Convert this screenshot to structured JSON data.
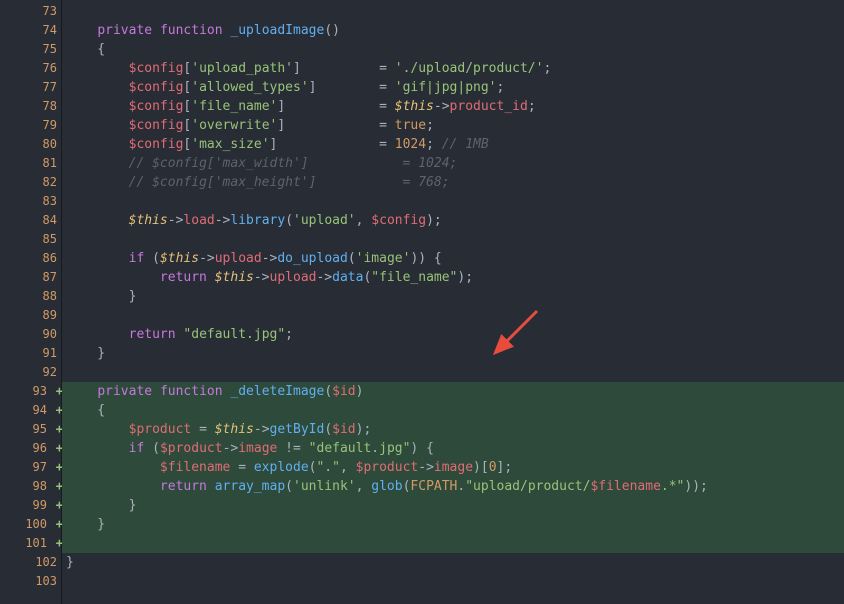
{
  "lines": [
    {
      "n": 73,
      "added": false,
      "tokens": [
        [
          "",
          ""
        ]
      ]
    },
    {
      "n": 74,
      "added": false,
      "tokens": [
        [
          "punct",
          "    "
        ],
        [
          "kw",
          "private"
        ],
        [
          "punct",
          " "
        ],
        [
          "kw",
          "function"
        ],
        [
          "punct",
          " "
        ],
        [
          "fn",
          "_uploadImage"
        ],
        [
          "punct",
          "()"
        ]
      ]
    },
    {
      "n": 75,
      "added": false,
      "tokens": [
        [
          "punct",
          "    {"
        ]
      ]
    },
    {
      "n": 76,
      "added": false,
      "tokens": [
        [
          "punct",
          "        "
        ],
        [
          "var",
          "$config"
        ],
        [
          "punct",
          "["
        ],
        [
          "str",
          "'upload_path'"
        ],
        [
          "punct",
          "]          = "
        ],
        [
          "str",
          "'./upload/product/'"
        ],
        [
          "punct",
          ";"
        ]
      ]
    },
    {
      "n": 77,
      "added": false,
      "tokens": [
        [
          "punct",
          "        "
        ],
        [
          "var",
          "$config"
        ],
        [
          "punct",
          "["
        ],
        [
          "str",
          "'allowed_types'"
        ],
        [
          "punct",
          "]        = "
        ],
        [
          "str",
          "'gif|jpg|png'"
        ],
        [
          "punct",
          ";"
        ]
      ]
    },
    {
      "n": 78,
      "added": false,
      "tokens": [
        [
          "punct",
          "        "
        ],
        [
          "var",
          "$config"
        ],
        [
          "punct",
          "["
        ],
        [
          "str",
          "'file_name'"
        ],
        [
          "punct",
          "]            = "
        ],
        [
          "this",
          "$this"
        ],
        [
          "punct",
          "->"
        ],
        [
          "prop",
          "product_id"
        ],
        [
          "punct",
          ";"
        ]
      ]
    },
    {
      "n": 79,
      "added": false,
      "tokens": [
        [
          "punct",
          "        "
        ],
        [
          "var",
          "$config"
        ],
        [
          "punct",
          "["
        ],
        [
          "str",
          "'overwrite'"
        ],
        [
          "punct",
          "]            = "
        ],
        [
          "bool",
          "true"
        ],
        [
          "punct",
          ";"
        ]
      ]
    },
    {
      "n": 80,
      "added": false,
      "tokens": [
        [
          "punct",
          "        "
        ],
        [
          "var",
          "$config"
        ],
        [
          "punct",
          "["
        ],
        [
          "str",
          "'max_size'"
        ],
        [
          "punct",
          "]             = "
        ],
        [
          "num",
          "1024"
        ],
        [
          "punct",
          "; "
        ],
        [
          "cmt",
          "// 1MB"
        ]
      ]
    },
    {
      "n": 81,
      "added": false,
      "tokens": [
        [
          "punct",
          "        "
        ],
        [
          "cmt",
          "// $config['max_width']            = 1024;"
        ]
      ]
    },
    {
      "n": 82,
      "added": false,
      "tokens": [
        [
          "punct",
          "        "
        ],
        [
          "cmt",
          "// $config['max_height']           = 768;"
        ]
      ]
    },
    {
      "n": 83,
      "added": false,
      "tokens": [
        [
          "",
          ""
        ]
      ]
    },
    {
      "n": 84,
      "added": false,
      "tokens": [
        [
          "punct",
          "        "
        ],
        [
          "this",
          "$this"
        ],
        [
          "punct",
          "->"
        ],
        [
          "prop",
          "load"
        ],
        [
          "punct",
          "->"
        ],
        [
          "call",
          "library"
        ],
        [
          "punct",
          "("
        ],
        [
          "str",
          "'upload'"
        ],
        [
          "punct",
          ", "
        ],
        [
          "var",
          "$config"
        ],
        [
          "punct",
          ");"
        ]
      ]
    },
    {
      "n": 85,
      "added": false,
      "tokens": [
        [
          "",
          ""
        ]
      ]
    },
    {
      "n": 86,
      "added": false,
      "tokens": [
        [
          "punct",
          "        "
        ],
        [
          "kw",
          "if"
        ],
        [
          "punct",
          " ("
        ],
        [
          "this",
          "$this"
        ],
        [
          "punct",
          "->"
        ],
        [
          "prop",
          "upload"
        ],
        [
          "punct",
          "->"
        ],
        [
          "call",
          "do_upload"
        ],
        [
          "punct",
          "("
        ],
        [
          "str",
          "'image'"
        ],
        [
          "punct",
          ")) {"
        ]
      ]
    },
    {
      "n": 87,
      "added": false,
      "tokens": [
        [
          "punct",
          "            "
        ],
        [
          "kw",
          "return"
        ],
        [
          "punct",
          " "
        ],
        [
          "this",
          "$this"
        ],
        [
          "punct",
          "->"
        ],
        [
          "prop",
          "upload"
        ],
        [
          "punct",
          "->"
        ],
        [
          "call",
          "data"
        ],
        [
          "punct",
          "("
        ],
        [
          "str",
          "\"file_name\""
        ],
        [
          "punct",
          ");"
        ]
      ]
    },
    {
      "n": 88,
      "added": false,
      "tokens": [
        [
          "punct",
          "        }"
        ]
      ]
    },
    {
      "n": 89,
      "added": false,
      "tokens": [
        [
          "",
          ""
        ]
      ]
    },
    {
      "n": 90,
      "added": false,
      "tokens": [
        [
          "punct",
          "        "
        ],
        [
          "kw",
          "return"
        ],
        [
          "punct",
          " "
        ],
        [
          "str",
          "\"default.jpg\""
        ],
        [
          "punct",
          ";"
        ]
      ]
    },
    {
      "n": 91,
      "added": false,
      "tokens": [
        [
          "punct",
          "    }"
        ]
      ]
    },
    {
      "n": 92,
      "added": false,
      "tokens": [
        [
          "",
          ""
        ]
      ]
    },
    {
      "n": 93,
      "added": true,
      "tokens": [
        [
          "punct",
          "    "
        ],
        [
          "kw",
          "private"
        ],
        [
          "punct",
          " "
        ],
        [
          "kw",
          "function"
        ],
        [
          "punct",
          " "
        ],
        [
          "fn",
          "_deleteImage"
        ],
        [
          "punct",
          "("
        ],
        [
          "var",
          "$id"
        ],
        [
          "punct",
          ")"
        ]
      ]
    },
    {
      "n": 94,
      "added": true,
      "tokens": [
        [
          "punct",
          "    {"
        ]
      ]
    },
    {
      "n": 95,
      "added": true,
      "tokens": [
        [
          "punct",
          "        "
        ],
        [
          "var",
          "$product"
        ],
        [
          "punct",
          " = "
        ],
        [
          "this",
          "$this"
        ],
        [
          "punct",
          "->"
        ],
        [
          "call",
          "getById"
        ],
        [
          "punct",
          "("
        ],
        [
          "var",
          "$id"
        ],
        [
          "punct",
          ");"
        ]
      ]
    },
    {
      "n": 96,
      "added": true,
      "tokens": [
        [
          "punct",
          "        "
        ],
        [
          "kw",
          "if"
        ],
        [
          "punct",
          " ("
        ],
        [
          "var",
          "$product"
        ],
        [
          "punct",
          "->"
        ],
        [
          "prop",
          "image"
        ],
        [
          "punct",
          " != "
        ],
        [
          "str",
          "\"default.jpg\""
        ],
        [
          "punct",
          ") {"
        ]
      ]
    },
    {
      "n": 97,
      "added": true,
      "tokens": [
        [
          "punct",
          "            "
        ],
        [
          "var",
          "$filename"
        ],
        [
          "punct",
          " = "
        ],
        [
          "call",
          "explode"
        ],
        [
          "punct",
          "("
        ],
        [
          "str",
          "\".\""
        ],
        [
          "punct",
          ", "
        ],
        [
          "var",
          "$product"
        ],
        [
          "punct",
          "->"
        ],
        [
          "prop",
          "image"
        ],
        [
          "punct",
          ")["
        ],
        [
          "num",
          "0"
        ],
        [
          "punct",
          "];"
        ]
      ]
    },
    {
      "n": 98,
      "added": true,
      "tokens": [
        [
          "punct",
          "            "
        ],
        [
          "kw",
          "return"
        ],
        [
          "punct",
          " "
        ],
        [
          "call",
          "array_map"
        ],
        [
          "punct",
          "("
        ],
        [
          "str",
          "'unlink'"
        ],
        [
          "punct",
          ", "
        ],
        [
          "call",
          "glob"
        ],
        [
          "punct",
          "("
        ],
        [
          "const",
          "FCPATH"
        ],
        [
          "punct",
          "."
        ],
        [
          "str",
          "\"upload/product/"
        ],
        [
          "var",
          "$filename"
        ],
        [
          "str",
          ".*\""
        ],
        [
          "punct",
          "));"
        ]
      ]
    },
    {
      "n": 99,
      "added": true,
      "tokens": [
        [
          "punct",
          "        }"
        ]
      ]
    },
    {
      "n": 100,
      "added": true,
      "tokens": [
        [
          "punct",
          "    }"
        ]
      ]
    },
    {
      "n": 101,
      "added": true,
      "tokens": [
        [
          "",
          ""
        ]
      ]
    },
    {
      "n": 102,
      "added": false,
      "tokens": [
        [
          "punct",
          "}"
        ]
      ]
    },
    {
      "n": 103,
      "added": false,
      "tokens": [
        [
          "",
          ""
        ]
      ]
    }
  ],
  "arrow_color": "#e74c3c"
}
